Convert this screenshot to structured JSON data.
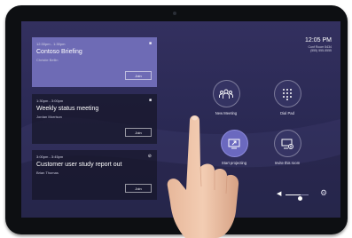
{
  "clock": {
    "time": "12:05 PM",
    "room": "Conf Room 5434",
    "phone": "(555) 555-5555"
  },
  "meetings": [
    {
      "time": "12:30pm - 1:30pm",
      "title": "Contoso Briefing",
      "organizer": "Christie Bellin",
      "join_label": "Join",
      "type_icon": "video-camera-icon",
      "active": true
    },
    {
      "time": "1:30pm - 3:00pm",
      "title": "Weekly status meeting",
      "organizer": "Jordan Morrison",
      "join_label": "Join",
      "type_icon": "video-camera-icon",
      "active": false
    },
    {
      "time": "3:00pm - 3:45pm",
      "title": "Customer user study report out",
      "organizer": "Brian Thomas",
      "join_label": "Join",
      "type_icon": "link-icon",
      "active": false
    }
  ],
  "actions": [
    {
      "label": "New Meeting",
      "icon": "people-icon"
    },
    {
      "label": "Dial Pad",
      "icon": "dialpad-icon"
    },
    {
      "label": "Start projecting",
      "icon": "project-screen-icon",
      "primary": true
    },
    {
      "label": "Invite this room",
      "icon": "invite-room-icon"
    }
  ],
  "volume": {
    "level": 0.65,
    "icon": "speaker-icon"
  },
  "settings": {
    "icon": "gear-icon"
  },
  "colors": {
    "screen_background": "#2c2a58",
    "active_card": "#6e6bb5",
    "accent": "#6b69bf",
    "bezel": "#0d0f12"
  }
}
